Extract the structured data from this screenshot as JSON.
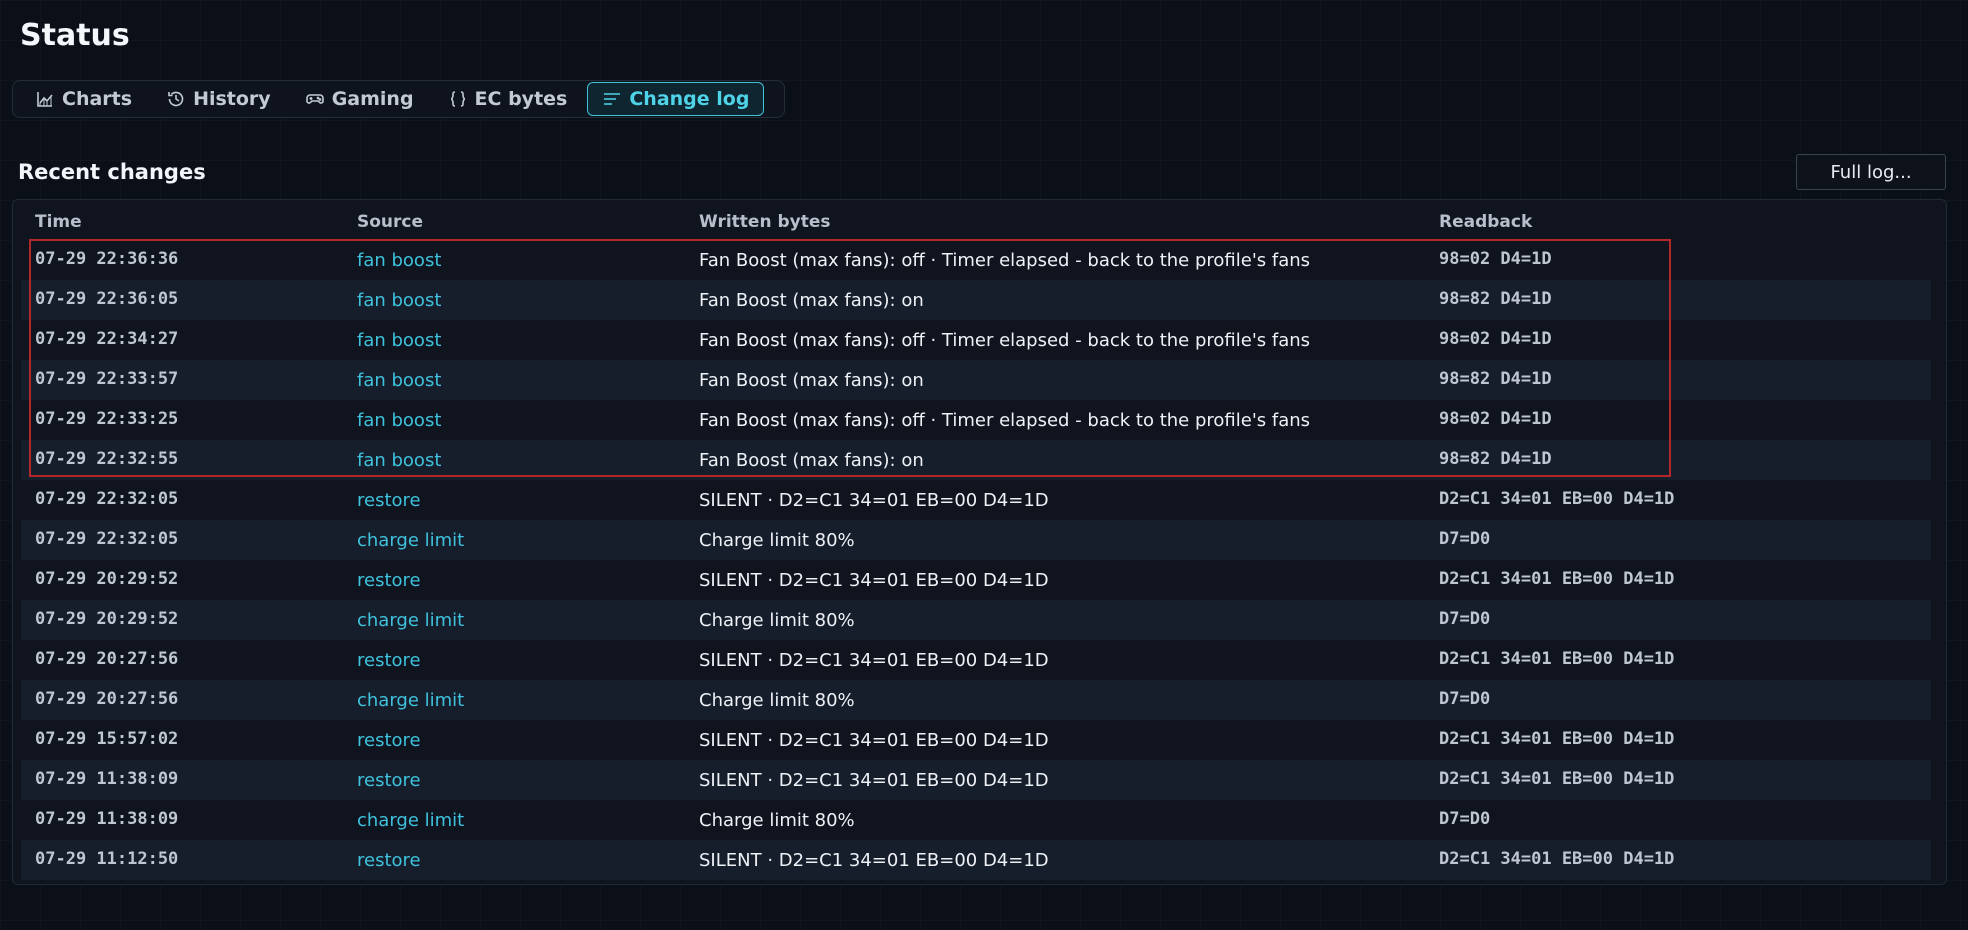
{
  "page": {
    "title": "Status"
  },
  "tabs": [
    {
      "label": "Charts",
      "icon": "chart-icon",
      "active": false
    },
    {
      "label": "History",
      "icon": "history-icon",
      "active": false
    },
    {
      "label": "Gaming",
      "icon": "gamepad-icon",
      "active": false
    },
    {
      "label": "EC bytes",
      "icon": "braces-icon",
      "active": false
    },
    {
      "label": "Change log",
      "icon": "list-icon",
      "active": true
    }
  ],
  "section": {
    "title": "Recent changes",
    "full_log_label": "Full log..."
  },
  "table": {
    "columns": {
      "time": "Time",
      "source": "Source",
      "written": "Written bytes",
      "readback": "Readback"
    },
    "rows": [
      {
        "time": "07-29 22:36:36",
        "source": "fan boost",
        "written": "Fan Boost (max fans): off  ·  Timer elapsed - back to the profile's fans",
        "readback": "98=02 D4=1D"
      },
      {
        "time": "07-29 22:36:05",
        "source": "fan boost",
        "written": "Fan Boost (max fans): on",
        "readback": "98=82 D4=1D"
      },
      {
        "time": "07-29 22:34:27",
        "source": "fan boost",
        "written": "Fan Boost (max fans): off  ·  Timer elapsed - back to the profile's fans",
        "readback": "98=02 D4=1D"
      },
      {
        "time": "07-29 22:33:57",
        "source": "fan boost",
        "written": "Fan Boost (max fans): on",
        "readback": "98=82 D4=1D"
      },
      {
        "time": "07-29 22:33:25",
        "source": "fan boost",
        "written": "Fan Boost (max fans): off  ·  Timer elapsed - back to the profile's fans",
        "readback": "98=02 D4=1D"
      },
      {
        "time": "07-29 22:32:55",
        "source": "fan boost",
        "written": "Fan Boost (max fans): on",
        "readback": "98=82 D4=1D"
      },
      {
        "time": "07-29 22:32:05",
        "source": "restore",
        "written": "SILENT  ·  D2=C1 34=01 EB=00 D4=1D",
        "readback": "D2=C1 34=01 EB=00 D4=1D"
      },
      {
        "time": "07-29 22:32:05",
        "source": "charge limit",
        "written": "Charge limit 80%",
        "readback": "D7=D0"
      },
      {
        "time": "07-29 20:29:52",
        "source": "restore",
        "written": "SILENT  ·  D2=C1 34=01 EB=00 D4=1D",
        "readback": "D2=C1 34=01 EB=00 D4=1D"
      },
      {
        "time": "07-29 20:29:52",
        "source": "charge limit",
        "written": "Charge limit 80%",
        "readback": "D7=D0"
      },
      {
        "time": "07-29 20:27:56",
        "source": "restore",
        "written": "SILENT  ·  D2=C1 34=01 EB=00 D4=1D",
        "readback": "D2=C1 34=01 EB=00 D4=1D"
      },
      {
        "time": "07-29 20:27:56",
        "source": "charge limit",
        "written": "Charge limit 80%",
        "readback": "D7=D0"
      },
      {
        "time": "07-29 15:57:02",
        "source": "restore",
        "written": "SILENT  ·  D2=C1 34=01 EB=00 D4=1D",
        "readback": "D2=C1 34=01 EB=00 D4=1D"
      },
      {
        "time": "07-29 11:38:09",
        "source": "restore",
        "written": "SILENT  ·  D2=C1 34=01 EB=00 D4=1D",
        "readback": "D2=C1 34=01 EB=00 D4=1D"
      },
      {
        "time": "07-29 11:38:09",
        "source": "charge limit",
        "written": "Charge limit 80%",
        "readback": "D7=D0"
      },
      {
        "time": "07-29 11:12:50",
        "source": "restore",
        "written": "SILENT  ·  D2=C1 34=01 EB=00 D4=1D",
        "readback": "D2=C1 34=01 EB=00 D4=1D"
      }
    ]
  },
  "colors": {
    "accent": "#3ec2dd",
    "highlight": "#b3262a",
    "background": "#0b0f18"
  }
}
